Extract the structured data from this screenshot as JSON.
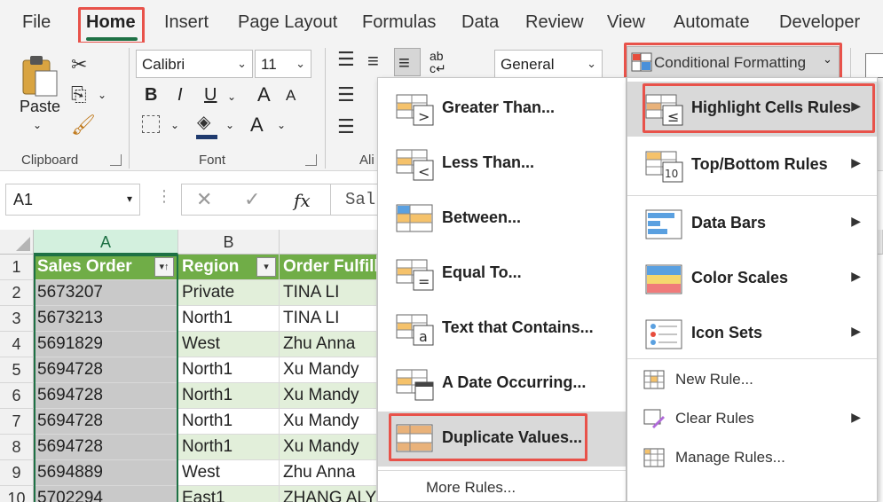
{
  "tabs": [
    "File",
    "Home",
    "Insert",
    "Page Layout",
    "Formulas",
    "Data",
    "Review",
    "View",
    "Automate",
    "Developer"
  ],
  "active_tab": "Home",
  "ribbon": {
    "paste_label": "Paste",
    "font_name": "Calibri",
    "font_size": "11",
    "number_format": "General",
    "conditional_formatting_label": "Conditional Formatting",
    "group_clipboard": "Clipboard",
    "group_font": "Font",
    "group_alignment_partial": "Ali",
    "bold": "B",
    "italic": "I",
    "underline": "U",
    "grow_font": "A",
    "shrink_font": "A",
    "font_color": "A"
  },
  "formula_bar": {
    "name_box": "A1",
    "fx": "fx",
    "content_partial": "Sal"
  },
  "grid": {
    "columns": [
      "A",
      "B"
    ],
    "headers": [
      "Sales Order",
      "Region",
      "Order Fulfill"
    ],
    "row_numbers": [
      "1",
      "2",
      "3",
      "4",
      "5",
      "6",
      "7",
      "8",
      "9",
      "10"
    ],
    "rows": [
      [
        "5673207",
        "Private",
        "TINA LI"
      ],
      [
        "5673213",
        "North1",
        "TINA LI"
      ],
      [
        "5691829",
        "West",
        "Zhu Anna"
      ],
      [
        "5694728",
        "North1",
        "Xu Mandy"
      ],
      [
        "5694728",
        "North1",
        "Xu Mandy"
      ],
      [
        "5694728",
        "North1",
        "Xu Mandy"
      ],
      [
        "5694728",
        "North1",
        "Xu Mandy"
      ],
      [
        "5694889",
        "West",
        "Zhu Anna"
      ],
      [
        "5702294",
        "East1",
        "ZHANG ALY"
      ]
    ]
  },
  "submenu": {
    "items": [
      {
        "label": "Greater Than...",
        "icon": "greater-than-icon"
      },
      {
        "label": "Less Than...",
        "icon": "less-than-icon"
      },
      {
        "label": "Between...",
        "icon": "between-icon"
      },
      {
        "label": "Equal To...",
        "icon": "equal-to-icon"
      },
      {
        "label": "Text that Contains...",
        "icon": "text-contains-icon"
      },
      {
        "label": "A Date Occurring...",
        "icon": "date-occurring-icon"
      },
      {
        "label": "Duplicate Values...",
        "icon": "duplicate-values-icon"
      }
    ],
    "more_rules": "More Rules..."
  },
  "cf_menu": {
    "items": [
      {
        "label": "Highlight Cells Rules",
        "icon": "highlight-cells-icon"
      },
      {
        "label": "Top/Bottom Rules",
        "icon": "top-bottom-icon"
      },
      {
        "label": "Data Bars",
        "icon": "data-bars-icon"
      },
      {
        "label": "Color Scales",
        "icon": "color-scales-icon"
      },
      {
        "label": "Icon Sets",
        "icon": "icon-sets-icon"
      }
    ],
    "new_rule": "New Rule...",
    "clear_rules": "Clear Rules",
    "manage_rules": "Manage Rules..."
  },
  "colors": {
    "accent_green": "#1e7145",
    "table_header": "#70ad47",
    "band": "#e2efda",
    "highlight_red": "#e8524a"
  }
}
